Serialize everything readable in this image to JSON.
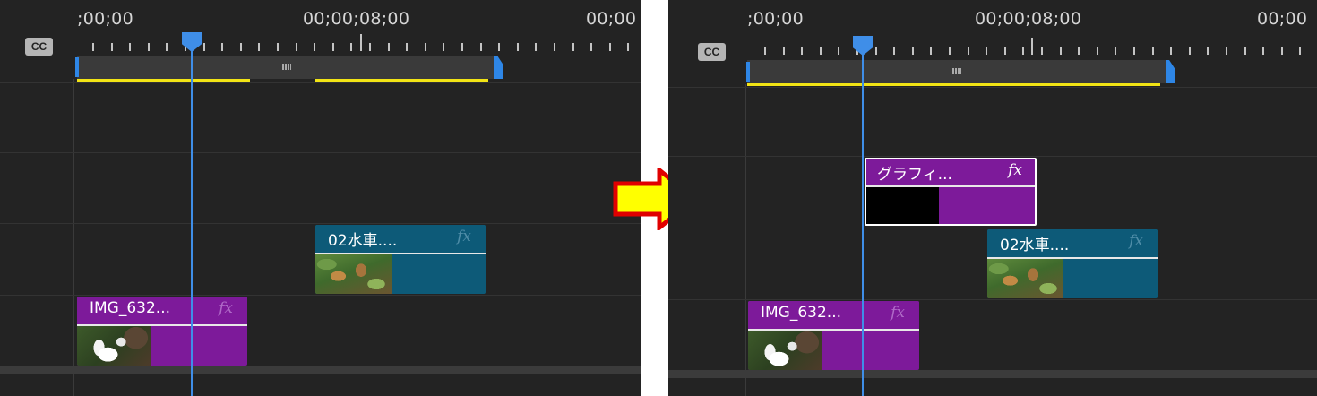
{
  "timecodes": {
    "start": ";00;00",
    "mid": "00;00;08;00",
    "end": "00;00"
  },
  "captions_badge": "CC",
  "workbar_grip_icon": "grip-icon",
  "colors": {
    "background": "#232323",
    "playhead": "#3f8ee8",
    "work_area_marker": "#2e86e6",
    "render_bar": "#f2e415",
    "clip_purple": "#7d1a9a",
    "clip_teal": "#0d5a78",
    "selection_border": "#ffffff",
    "arrow_fill": "#ffff00",
    "arrow_stroke": "#e00000"
  },
  "before": {
    "clips": {
      "video1": {
        "name": "IMG_632...",
        "fx": "fx"
      },
      "video2": {
        "name": "02水車....",
        "fx": "fx"
      }
    }
  },
  "after": {
    "clips": {
      "video1": {
        "name": "IMG_632...",
        "fx": "fx"
      },
      "video2": {
        "name": "02水車....",
        "fx": "fx"
      },
      "video3": {
        "name": "グラフィ...",
        "fx": "fx",
        "selected": true
      }
    }
  },
  "transition_arrow_icon": "right-arrow-icon"
}
